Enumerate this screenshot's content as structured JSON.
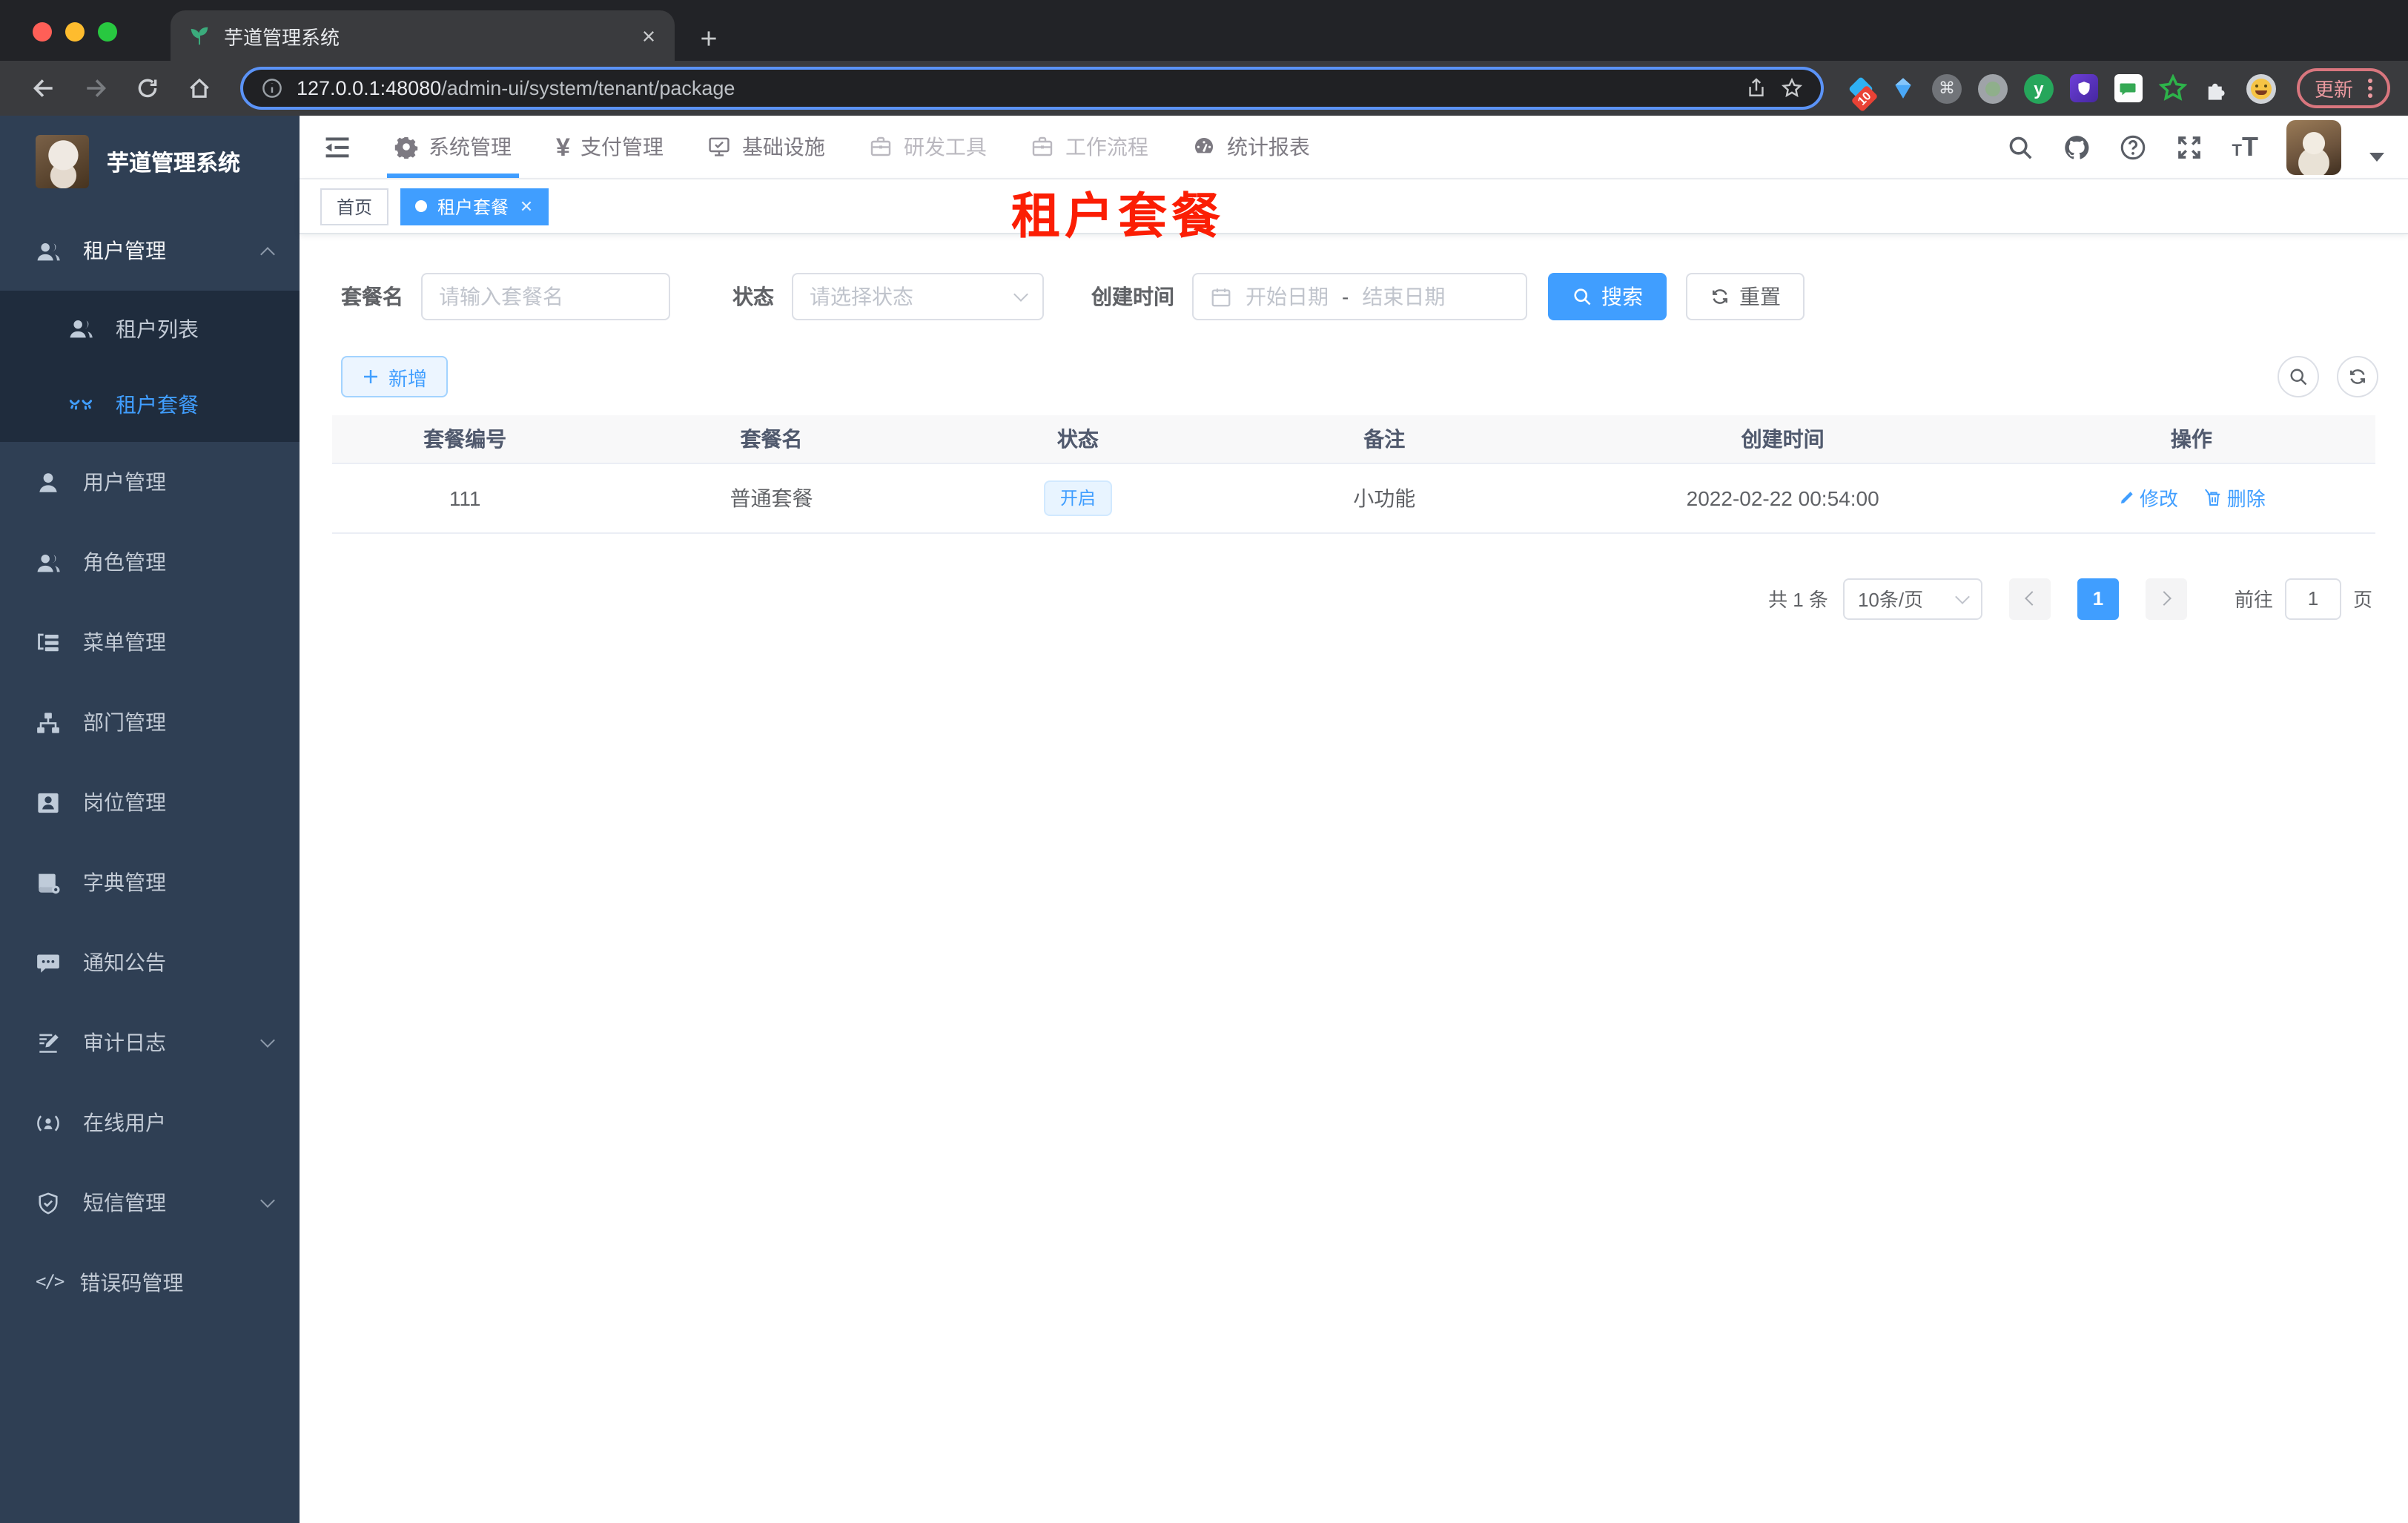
{
  "colors": {
    "accent": "#409eff",
    "annotation_red": "#fb1e04",
    "sidebar_bg": "#2f3f54",
    "submenu_bg": "#1f2c3d",
    "status_tag_bg": "#e8f4ff"
  },
  "browser": {
    "tab_title": "芋道管理系统",
    "url_host": "127.0.0.1:48080",
    "url_path": "/admin-ui/system/tenant/package",
    "ext_badge": "10",
    "ext_cmd": "⌘",
    "ext_y": "y",
    "update_label": "更新"
  },
  "header": {
    "nav": [
      {
        "label": "系统管理"
      },
      {
        "label": "支付管理"
      },
      {
        "label": "基础设施"
      },
      {
        "label": "研发工具"
      },
      {
        "label": "工作流程"
      },
      {
        "label": "统计报表"
      }
    ],
    "yen_glyph": "¥",
    "font_small": "T",
    "font_large": "T"
  },
  "sidebar": {
    "logo_title": "芋道管理系统",
    "code_glyph": "</>",
    "items": [
      {
        "label": "租户管理"
      },
      {
        "label": "租户列表"
      },
      {
        "label": "租户套餐"
      },
      {
        "label": "用户管理"
      },
      {
        "label": "角色管理"
      },
      {
        "label": "菜单管理"
      },
      {
        "label": "部门管理"
      },
      {
        "label": "岗位管理"
      },
      {
        "label": "字典管理"
      },
      {
        "label": "通知公告"
      },
      {
        "label": "审计日志"
      },
      {
        "label": "在线用户"
      },
      {
        "label": "短信管理"
      },
      {
        "label": "错误码管理"
      }
    ]
  },
  "tags": {
    "home": "首页",
    "active": "租户套餐"
  },
  "annotation": {
    "text": "租户套餐"
  },
  "filters": {
    "name_label": "套餐名",
    "name_placeholder": "请输入套餐名",
    "status_label": "状态",
    "status_placeholder": "请选择状态",
    "time_label": "创建时间",
    "start_placeholder": "开始日期",
    "separator": "-",
    "end_placeholder": "结束日期",
    "search_label": "搜索",
    "reset_label": "重置"
  },
  "toolbar": {
    "add_label": "新增"
  },
  "table": {
    "headers": [
      "套餐编号",
      "套餐名",
      "状态",
      "备注",
      "创建时间",
      "操作"
    ],
    "rows": [
      {
        "id": "111",
        "name": "普通套餐",
        "status": "开启",
        "remark": "小功能",
        "created": "2022-02-22 00:54:00",
        "edit_label": "修改",
        "delete_label": "删除"
      }
    ]
  },
  "pagination": {
    "total": "共 1 条",
    "page_size": "10条/页",
    "page": "1",
    "goto_label": "前往",
    "goto_value": "1",
    "unit_label": "页"
  }
}
